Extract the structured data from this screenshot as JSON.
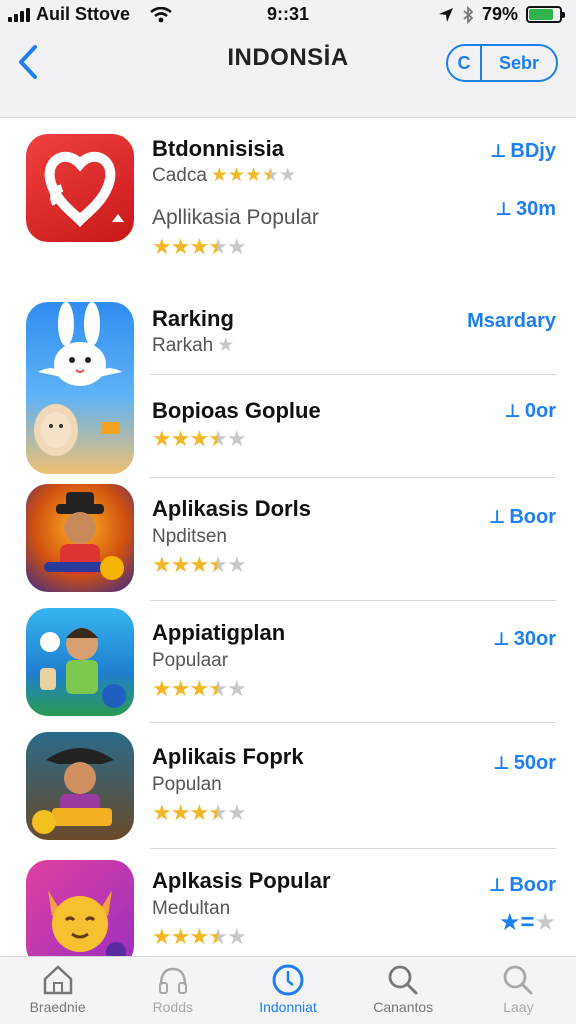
{
  "status_bar": {
    "carrier": "Auil Sttove",
    "time": "9::31",
    "battery_text": "79%",
    "battery_level": 0.79,
    "battery_color": "#2fb34a"
  },
  "nav": {
    "title": "INDONSİA",
    "pill_letter": "C",
    "pill_label": "Sebr"
  },
  "apps": [
    {
      "name": "Btdonnisisia",
      "subtitle": "Cadca",
      "subtitle2": "Apllikasia Popular",
      "rating": 3.5,
      "action": "BDjy",
      "action2": "30m",
      "icon": "heart-logo-icon"
    },
    {
      "name": "Rarking",
      "subtitle": "Rarkah",
      "rating": 1,
      "action": "Msardary",
      "icon": "rabbit-icon"
    },
    {
      "name": "Bopioas Goplue",
      "subtitle": "",
      "rating": 3.5,
      "action": "0or",
      "icon": "girl-character-icon"
    },
    {
      "name": "Aplikasis Dorls",
      "subtitle": "Npditsen",
      "rating": 3.5,
      "action": "Boor",
      "icon": "cowboy-character-icon"
    },
    {
      "name": "Appiatigplan",
      "subtitle": "Populaar",
      "rating": 3.5,
      "action": "30or",
      "icon": "boy-character-icon"
    },
    {
      "name": "Aplikais Foprk",
      "subtitle": "Populan",
      "rating": 3.5,
      "action": "50or",
      "icon": "hat-character-icon"
    },
    {
      "name": "Aplkasis Popular",
      "subtitle": "Medultan",
      "rating": 3.5,
      "action": "Boor",
      "action_stars": 1,
      "icon": "smiley-fox-icon"
    }
  ],
  "tabs": [
    {
      "label": "Braednie",
      "icon": "home-icon",
      "active": false
    },
    {
      "label": "Rodds",
      "icon": "headphones-icon",
      "active": false
    },
    {
      "label": "Indonniat",
      "icon": "clock-icon",
      "active": true
    },
    {
      "label": "Canantos",
      "icon": "search-icon",
      "active": false
    },
    {
      "label": "Laay",
      "icon": "search-icon",
      "active": false
    }
  ],
  "colors": {
    "accent": "#1d7ff0",
    "star": "#f2b825",
    "star_empty": "#c8c8cc"
  }
}
